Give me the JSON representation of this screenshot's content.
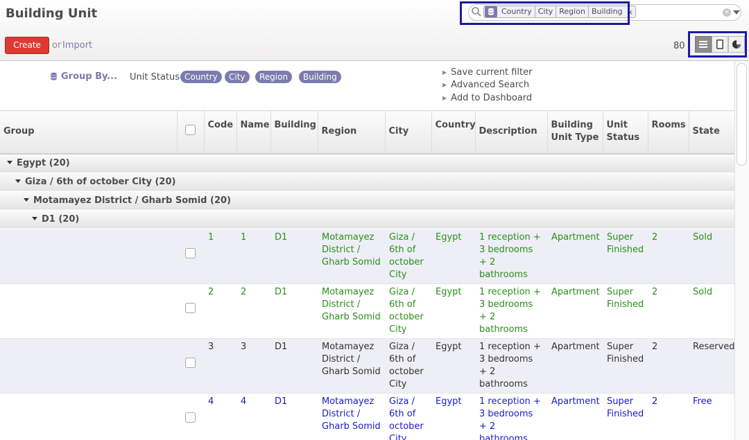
{
  "header": {
    "title": "Building Unit",
    "create_label": "Create",
    "or_label": "or",
    "import_label": "Import",
    "record_count": "80"
  },
  "search": {
    "facet_values": [
      "Country",
      "City",
      "Region",
      "Building"
    ],
    "facet_close": "x"
  },
  "views": [
    {
      "name": "list-view-button",
      "icon": "list-icon",
      "active": true
    },
    {
      "name": "form-view-button",
      "icon": "form-icon",
      "active": false
    },
    {
      "name": "graph-view-button",
      "icon": "pie-chart-icon",
      "active": false
    }
  ],
  "options": {
    "group_by_label": "Group By...",
    "unit_status_label": "Unit Status",
    "chips": [
      "Country",
      "City",
      "Region",
      "Building"
    ],
    "filter_actions": [
      "Save current filter",
      "Advanced Search",
      "Add to Dashboard"
    ]
  },
  "table": {
    "headers": {
      "group": "Group",
      "code": "Code",
      "name": "Name",
      "building": "Building",
      "region": "Region",
      "city": "City",
      "country": "Country",
      "description": "Description",
      "unit_type": "Building Unit Type",
      "unit_status": "Unit Status",
      "rooms": "Rooms",
      "state": "State"
    },
    "groups": [
      "Egypt (20)",
      "Giza / 6th of october City (20)",
      "Motamayez District / Gharb Somid (20)",
      "D1 (20)"
    ],
    "rows": [
      {
        "code": "1",
        "name": "1",
        "building": "D1",
        "region": "Motamayez District / Gharb Somid",
        "city": "Giza / 6th of october City",
        "country": "Egypt",
        "description": "1 reception + 3 bedrooms + 2 bathrooms",
        "unit_type": "Apartment",
        "unit_status": "Super Finished",
        "rooms": "2",
        "state": "Sold"
      },
      {
        "code": "2",
        "name": "2",
        "building": "D1",
        "region": "Motamayez District / Gharb Somid",
        "city": "Giza / 6th of october City",
        "country": "Egypt",
        "description": "1 reception + 3 bedrooms + 2 bathrooms",
        "unit_type": "Apartment",
        "unit_status": "Super Finished",
        "rooms": "2",
        "state": "Sold"
      },
      {
        "code": "3",
        "name": "3",
        "building": "D1",
        "region": "Motamayez District / Gharb Somid",
        "city": "Giza / 6th of october City",
        "country": "Egypt",
        "description": "1 reception + 3 bedrooms + 2 bathrooms",
        "unit_type": "Apartment",
        "unit_status": "Super Finished",
        "rooms": "2",
        "state": "Reserved"
      },
      {
        "code": "4",
        "name": "4",
        "building": "D1",
        "region": "Motamayez District / Gharb Somid",
        "city": "Giza / 6th of october City",
        "country": "Egypt",
        "description": "1 reception + 3 bedrooms + 2 bathrooms",
        "unit_type": "Apartment",
        "unit_status": "Super Finished",
        "rooms": "2",
        "state": "Free"
      }
    ]
  },
  "colors": {
    "accent": "#7c7bad",
    "create": "#dc3a33",
    "sold": "#2a8f1a",
    "reserved": "#333333",
    "free": "#1a1ad0",
    "highlight_box": "#1a1aa6"
  }
}
